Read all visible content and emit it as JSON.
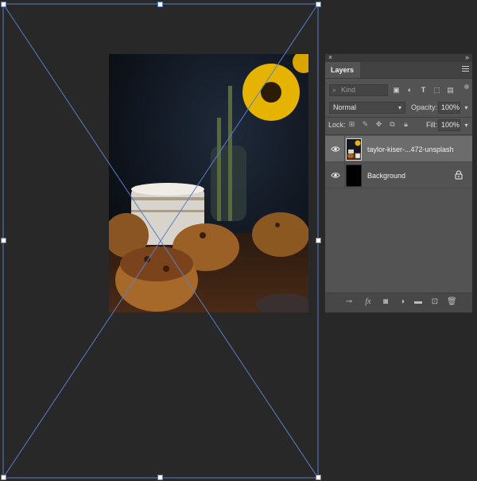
{
  "panel": {
    "title": "Layers",
    "close_glyph": "×",
    "collapse_glyph": "››",
    "filter": {
      "kind_placeholder": "Kind"
    },
    "blend_mode": "Normal",
    "opacity_label": "Opacity:",
    "opacity_value": "100%",
    "lock_label": "Lock:",
    "fill_label": "Fill:",
    "fill_value": "100%"
  },
  "layers": [
    {
      "name": "taylor-kiser-...472-unsplash",
      "visible": true,
      "selected": true,
      "locked": false,
      "kind": "smart-object"
    },
    {
      "name": "Background",
      "visible": true,
      "selected": false,
      "locked": true,
      "kind": "pixel"
    }
  ],
  "icons": {
    "filter": [
      "image-filter-icon",
      "adjustment-filter-icon",
      "type-filter-icon",
      "shape-filter-icon",
      "smart-object-filter-icon"
    ],
    "lock": [
      "lock-transparent-icon",
      "lock-image-icon",
      "lock-position-icon",
      "lock-artboard-icon",
      "lock-all-icon"
    ],
    "footer": [
      "link-layers-icon",
      "fx-icon",
      "add-mask-icon",
      "adjustment-layer-icon",
      "new-group-icon",
      "new-layer-icon",
      "trash-icon"
    ]
  },
  "colors": {
    "canvas_bg": "#282828",
    "panel_bg": "#535353",
    "selection": "#6c6c6c",
    "transform_line": "#5a7ec6"
  }
}
